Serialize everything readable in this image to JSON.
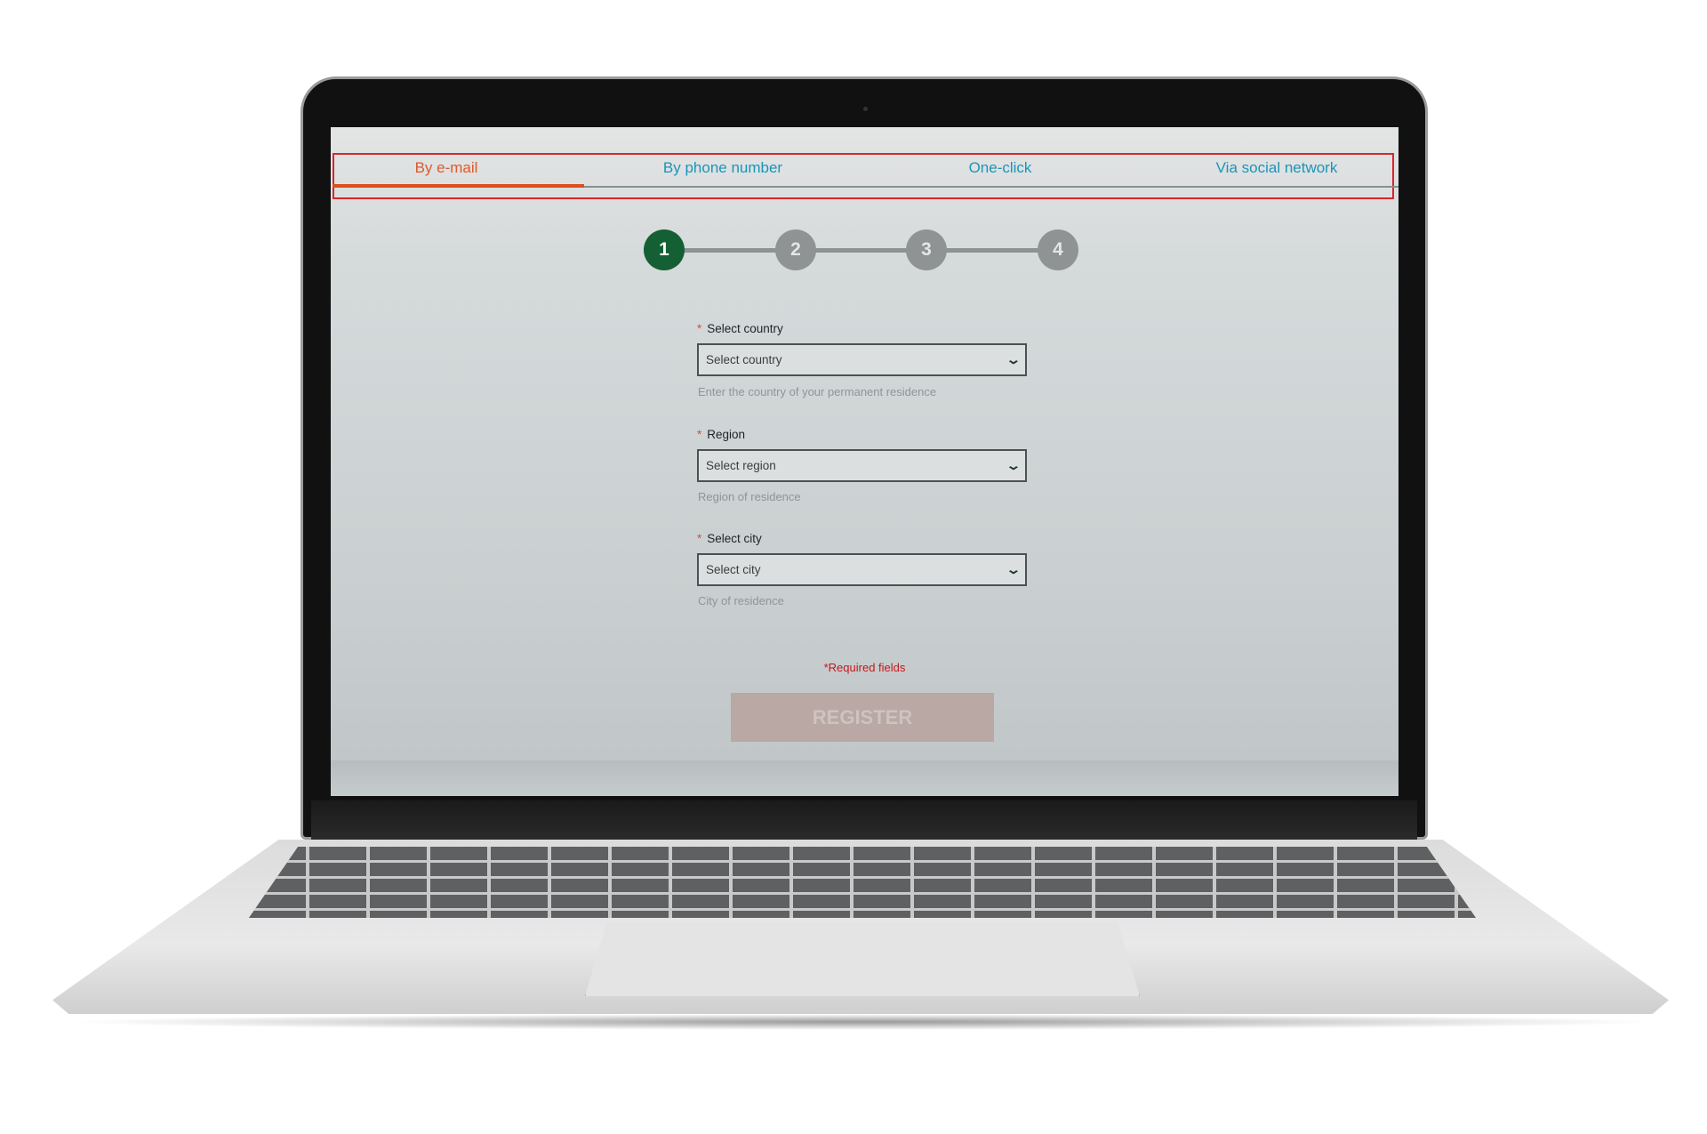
{
  "tabs": [
    {
      "label": "By e-mail",
      "active": true
    },
    {
      "label": "By phone number",
      "active": false
    },
    {
      "label": "One-click",
      "active": false
    },
    {
      "label": "Via social network",
      "active": false
    }
  ],
  "steps": [
    "1",
    "2",
    "3",
    "4"
  ],
  "current_step": 1,
  "form": {
    "country": {
      "label": "Select country",
      "placeholder": "Select country",
      "hint": "Enter the country of your permanent residence"
    },
    "region": {
      "label": "Region",
      "placeholder": "Select region",
      "hint": "Region of residence"
    },
    "city": {
      "label": "Select city",
      "placeholder": "Select city",
      "hint": "City of residence"
    },
    "required_star": "*",
    "required_note": "*Required fields",
    "register_label": "REGISTER"
  },
  "colors": {
    "accent": "#dc4f1e",
    "tab_link": "#1b95b8",
    "step_active": "#145f33",
    "highlight_box": "#d8262b"
  }
}
